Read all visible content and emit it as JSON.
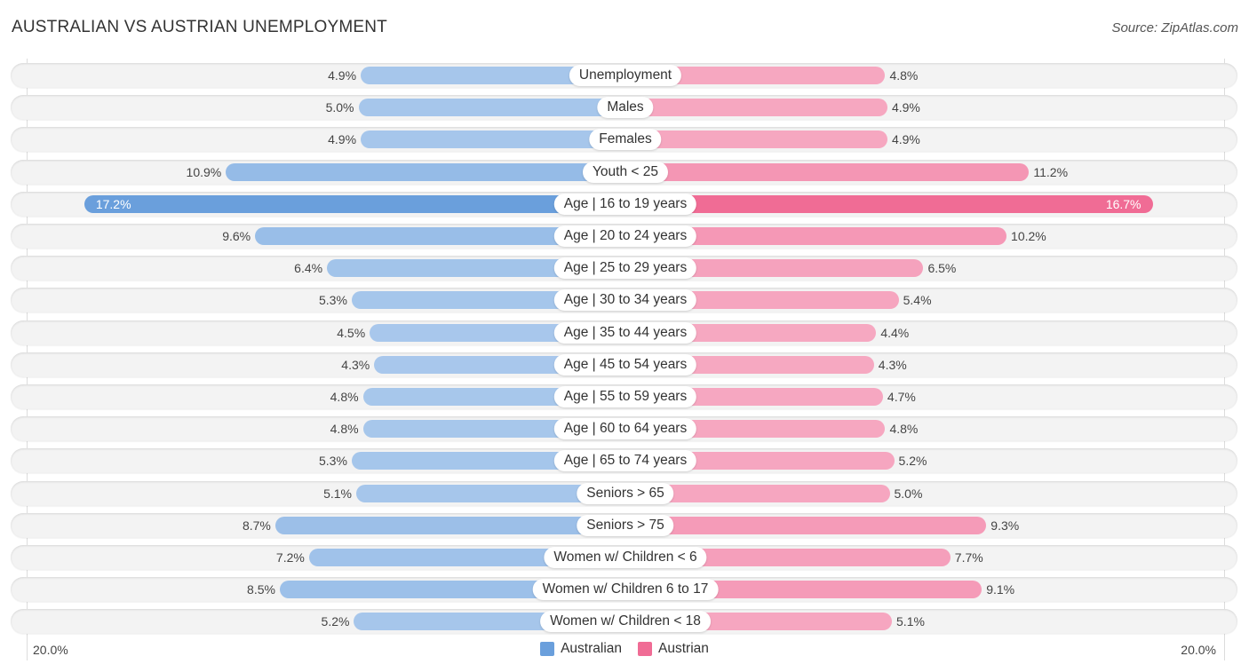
{
  "header": {
    "title": "AUSTRALIAN VS AUSTRIAN UNEMPLOYMENT",
    "source": "Source: ZipAtlas.com"
  },
  "colors": {
    "australian": "#6a9fdc",
    "australian_light": "#a6c6ea",
    "austrian": "#f06c95",
    "austrian_light": "#f4a6c0"
  },
  "chart_data": {
    "type": "bar",
    "orientation": "horizontal-diverging",
    "title": "AUSTRALIAN VS AUSTRIAN UNEMPLOYMENT",
    "xlabel": "",
    "ylabel": "",
    "xlim": [
      0,
      20.0
    ],
    "axis_ticks": [
      "20.0%",
      "20.0%"
    ],
    "legend": {
      "position": "bottom-center",
      "entries": [
        "Australian",
        "Austrian"
      ]
    },
    "categories": [
      "Unemployment",
      "Males",
      "Females",
      "Youth < 25",
      "Age | 16 to 19 years",
      "Age | 20 to 24 years",
      "Age | 25 to 29 years",
      "Age | 30 to 34 years",
      "Age | 35 to 44 years",
      "Age | 45 to 54 years",
      "Age | 55 to 59 years",
      "Age | 60 to 64 years",
      "Age | 65 to 74 years",
      "Seniors > 65",
      "Seniors > 75",
      "Women w/ Children < 6",
      "Women w/ Children 6 to 17",
      "Women w/ Children < 18"
    ],
    "series": [
      {
        "name": "Australian",
        "side": "left",
        "values": [
          4.9,
          5.0,
          4.9,
          10.9,
          17.2,
          9.6,
          6.4,
          5.3,
          4.5,
          4.3,
          4.8,
          4.8,
          5.3,
          5.1,
          8.7,
          7.2,
          8.5,
          5.2
        ]
      },
      {
        "name": "Austrian",
        "side": "right",
        "values": [
          4.8,
          4.9,
          4.9,
          11.2,
          16.7,
          10.2,
          6.5,
          5.4,
          4.4,
          4.3,
          4.7,
          4.8,
          5.2,
          5.0,
          9.3,
          7.7,
          9.1,
          5.1
        ]
      }
    ],
    "value_labels_suffix": "%"
  }
}
